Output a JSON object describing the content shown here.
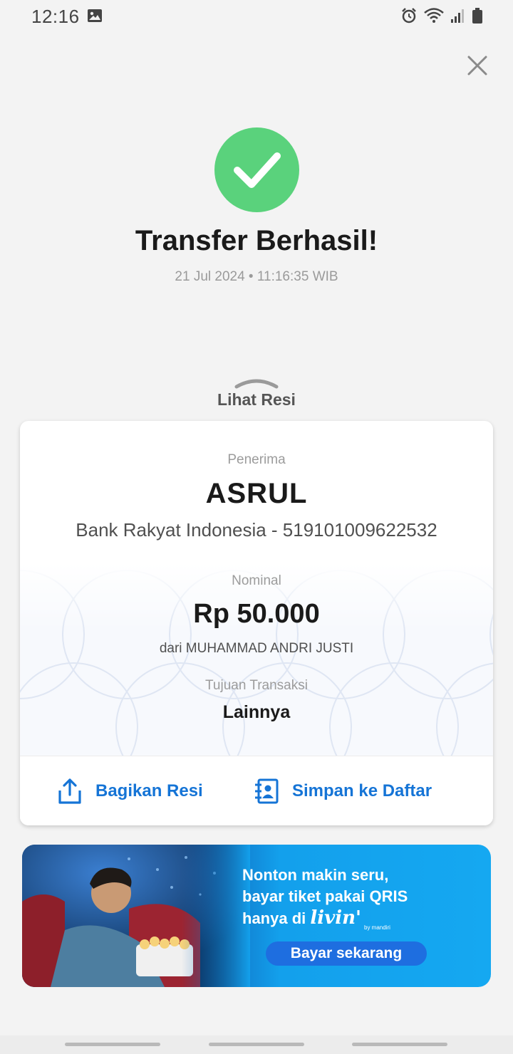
{
  "status_bar": {
    "time": "12:16",
    "icons": [
      "gallery-icon",
      "alarm-icon",
      "wifi-icon",
      "signal-icon",
      "battery-icon"
    ]
  },
  "header": {
    "close_icon": "close-icon"
  },
  "result": {
    "icon": "checkmark-icon",
    "accent_color": "#5ad27c",
    "title": "Transfer Berhasil!",
    "timestamp": "21 Jul 2024 • 11:16:35 WIB"
  },
  "receipt": {
    "toggle_label": "Lihat Resi",
    "recipient_label": "Penerima",
    "recipient_name": "ASRUL",
    "recipient_bank": "Bank Rakyat Indonesia - 519101009622532",
    "amount_label": "Nominal",
    "amount": "Rp 50.000",
    "sender": "dari MUHAMMAD ANDRI JUSTI",
    "purpose_label": "Tujuan Transaksi",
    "purpose": "Lainnya",
    "actions": {
      "share_label": "Bagikan Resi",
      "save_label": "Simpan ke Daftar"
    },
    "action_color": "#1574d6"
  },
  "promo": {
    "line1": "Nonton makin seru,",
    "line2": "bayar tiket pakai QRIS",
    "line3_prefix": "hanya di",
    "brand": "livin'",
    "brand_sub": "by mandiri",
    "cta": "Bayar sekarang"
  }
}
